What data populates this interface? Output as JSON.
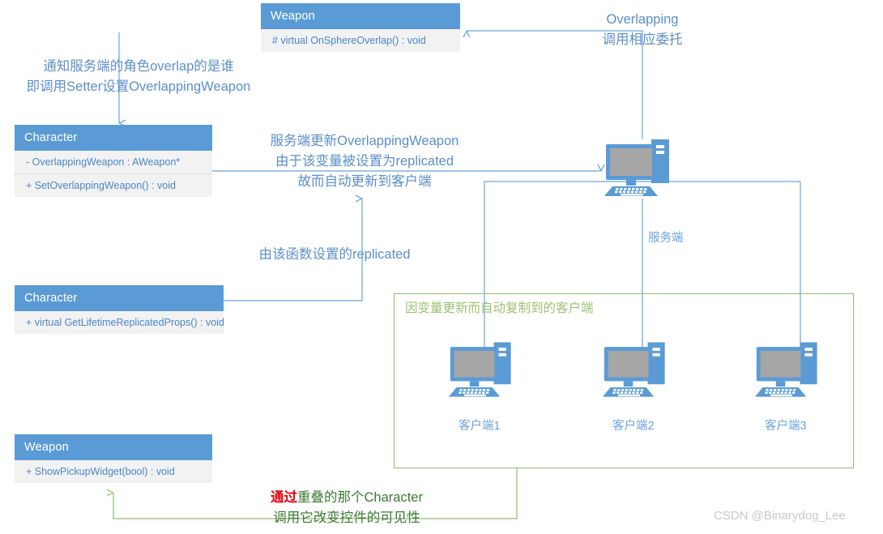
{
  "diagram": {
    "title": "UE Replication OverlappingWeapon Diagram",
    "colors": {
      "header_blue": "#5B9BD5",
      "body_gray": "#F2F2F2",
      "text_blue": "#4A86C8",
      "note_blue": "#5B8FC9",
      "green": "#8FBF6A",
      "green_text": "#9CC273",
      "dark_green_text": "#3C7A34",
      "red": "#E8000D",
      "watermark": "#C9C9C9",
      "screen_gray": "#A6A6A6"
    }
  },
  "classes": {
    "weapon_top": {
      "name": "Weapon",
      "members": [
        "# virtual OnSphereOverlap() : void"
      ]
    },
    "character_top": {
      "name": "Character",
      "members": [
        "- OverlappingWeapon : AWeapon*",
        "+ SetOverlappingWeapon() : void"
      ]
    },
    "character_bottom": {
      "name": "Character",
      "members": [
        "+ virtual GetLifetimeReplicatedProps() : void"
      ]
    },
    "weapon_bottom": {
      "name": "Weapon",
      "members": [
        "+ ShowPickupWidget(bool) : void"
      ]
    }
  },
  "notes": {
    "overlap_setter": {
      "line1": "通知服务端的角色overlap的是谁",
      "line2": "即调用Setter设置OverlappingWeapon"
    },
    "server_update": {
      "line1": "服务端更新OverlappingWeapon",
      "line2": "由于该变量被设置为replicated",
      "line3": "故而自动更新到客户端"
    },
    "overlapping_delegate": {
      "line1": "Overlapping",
      "line2": "调用相应委托"
    },
    "replicated_by_function": {
      "line1": "由该函数设置的replicated"
    },
    "bottom_call": {
      "highlight": "通过",
      "line1_rest": "重叠的那个Character",
      "line2": "调用它改变控件的可见性"
    }
  },
  "machines": {
    "server": {
      "label": "服务端",
      "icon": "desktop-computer-icon"
    },
    "clients": [
      {
        "label": "客户端1",
        "icon": "desktop-computer-icon"
      },
      {
        "label": "客户端2",
        "icon": "desktop-computer-icon"
      },
      {
        "label": "客户端3",
        "icon": "desktop-computer-icon"
      }
    ]
  },
  "group": {
    "clients_box_label": "因变量更新而自动复制到的客户端"
  },
  "watermark": {
    "text": "CSDN @Binarydog_Lee"
  }
}
